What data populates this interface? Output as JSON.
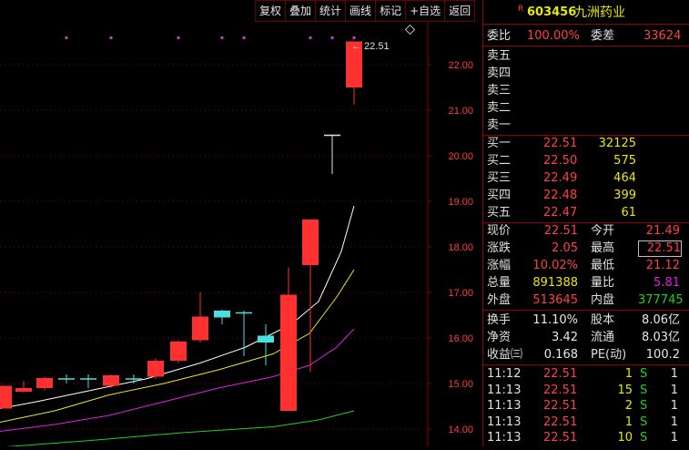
{
  "toolbar": [
    "复权",
    "叠加",
    "统计",
    "画线",
    "标记",
    "+自选",
    "返回"
  ],
  "chart": {
    "last_price_label": "← 22.51",
    "y_ticks": [
      "22.00",
      "21.00",
      "20.00",
      "19.00",
      "18.00",
      "17.00",
      "16.00",
      "15.00",
      "14.00"
    ]
  },
  "stock": {
    "badge": "R",
    "code": "603456",
    "name": "九洲药业"
  },
  "weibi": {
    "label1": "委比",
    "value1": "100.00%",
    "label2": "委差",
    "value2": "33624"
  },
  "sell": [
    {
      "label": "卖五",
      "price": "",
      "volume": ""
    },
    {
      "label": "卖四",
      "price": "",
      "volume": ""
    },
    {
      "label": "卖三",
      "price": "",
      "volume": ""
    },
    {
      "label": "卖二",
      "price": "",
      "volume": ""
    },
    {
      "label": "卖一",
      "price": "",
      "volume": ""
    }
  ],
  "buy": [
    {
      "label": "买一",
      "price": "22.51",
      "volume": "32125"
    },
    {
      "label": "买二",
      "price": "22.50",
      "volume": "575"
    },
    {
      "label": "买三",
      "price": "22.49",
      "volume": "464"
    },
    {
      "label": "买四",
      "price": "22.48",
      "volume": "399"
    },
    {
      "label": "买五",
      "price": "22.47",
      "volume": "61"
    }
  ],
  "quote": [
    {
      "l1": "现价",
      "v1": "22.51",
      "l2": "今开",
      "v2": "21.49"
    },
    {
      "l1": "涨跌",
      "v1": "2.05",
      "l2": "最高",
      "v2": "22.51"
    },
    {
      "l1": "涨幅",
      "v1": "10.02%",
      "l2": "最低",
      "v2": "21.12"
    },
    {
      "l1": "总量",
      "v1": "891388",
      "l2": "量比",
      "v2": "5.81"
    },
    {
      "l1": "外盘",
      "v1": "513645",
      "l2": "内盘",
      "v2": "377745"
    }
  ],
  "fundamentals": [
    {
      "l1": "换手",
      "v1": "11.10%",
      "l2": "股本",
      "v2": "8.06亿"
    },
    {
      "l1": "净资",
      "v1": "3.42",
      "l2": "流通",
      "v2": "8.03亿"
    },
    {
      "l1": "收益㈢",
      "v1": "0.168",
      "l2": "PE(动)",
      "v2": "100.2"
    }
  ],
  "ticks": [
    {
      "time": "11:12",
      "price": "22.51",
      "vol": "1",
      "side": "S",
      "num": "1"
    },
    {
      "time": "11:13",
      "price": "22.51",
      "vol": "15",
      "side": "S",
      "num": "1"
    },
    {
      "time": "11:13",
      "price": "22.51",
      "vol": "2",
      "side": "S",
      "num": "1"
    },
    {
      "time": "11:13",
      "price": "22.51",
      "vol": "1",
      "side": "S",
      "num": "1"
    },
    {
      "time": "11:13",
      "price": "22.51",
      "vol": "10",
      "side": "S",
      "num": "1"
    }
  ]
}
